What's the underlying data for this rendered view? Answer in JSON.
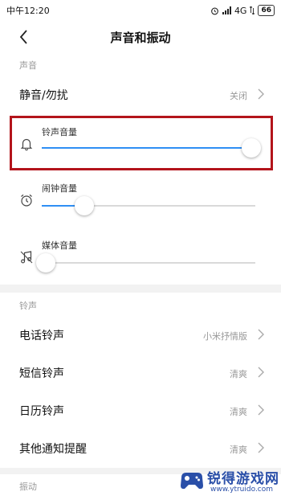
{
  "status_bar": {
    "time": "中午12:20",
    "network": "4G",
    "battery": "66"
  },
  "header": {
    "title": "声音和振动"
  },
  "sections": {
    "sound": {
      "title": "声音"
    },
    "ringtone": {
      "title": "铃声"
    },
    "vibration": {
      "title": "振动"
    }
  },
  "silent_row": {
    "label": "静音/勿扰",
    "value": "关闭"
  },
  "volumes": [
    {
      "label": "铃声音量",
      "icon": "bell-icon",
      "level": 0.98
    },
    {
      "label": "闹钟音量",
      "icon": "alarm-clock-icon",
      "level": 0.2
    },
    {
      "label": "媒体音量",
      "icon": "music-note-icon",
      "level": 0.02
    }
  ],
  "ringtone_rows": [
    {
      "label": "电话铃声",
      "value": "小米抒情版"
    },
    {
      "label": "短信铃声",
      "value": "清爽"
    },
    {
      "label": "日历铃声",
      "value": "清爽"
    },
    {
      "label": "其他通知提醒",
      "value": "清爽"
    }
  ],
  "watermark": {
    "title": "锐得游戏网",
    "url": "www.ytruido.com"
  },
  "colors": {
    "accent": "#2f8ff4",
    "highlight": "#b3141b",
    "secondary_text": "#999999",
    "watermark": "#2a4fa8"
  }
}
